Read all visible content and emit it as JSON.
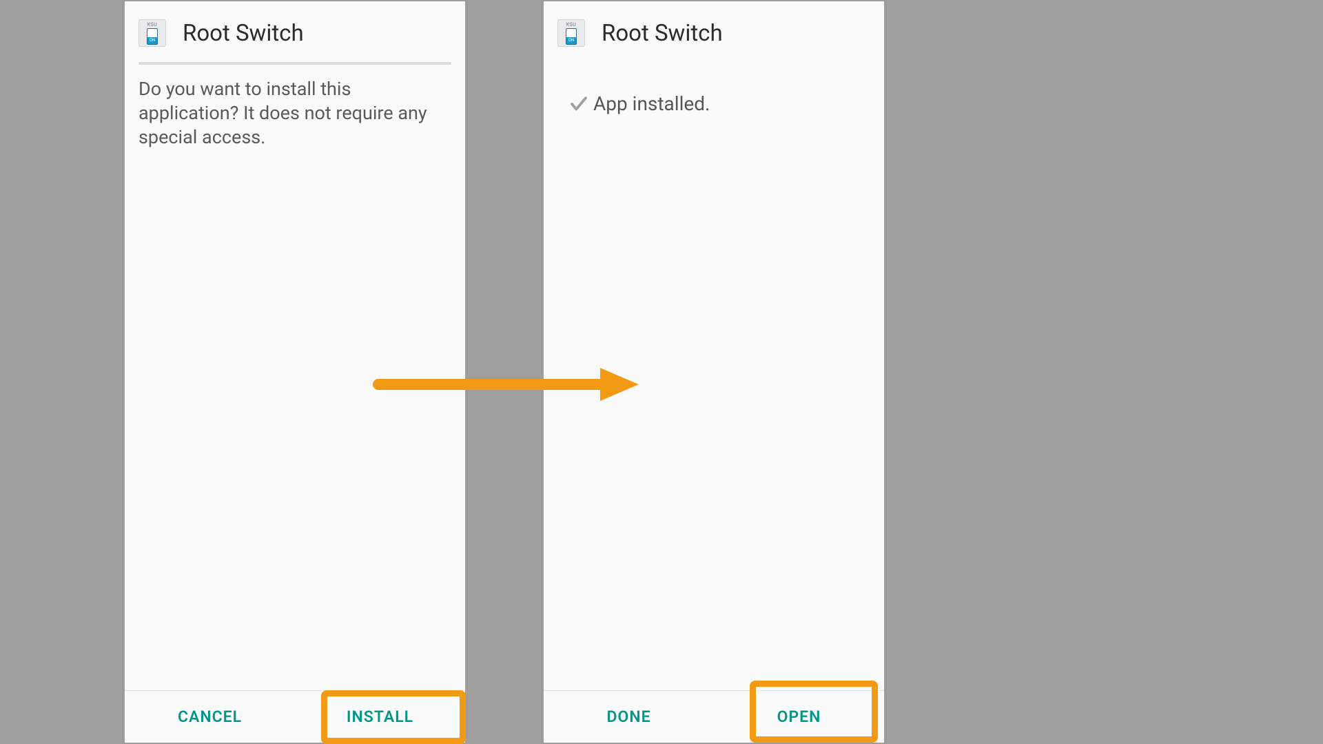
{
  "left": {
    "app_name": "Root Switch",
    "icon_caption": "KSU",
    "icon_tag": "ON",
    "body_text": "Do you want to install this application? It does not require any special access.",
    "cancel_label": "CANCEL",
    "install_label": "INSTALL"
  },
  "right": {
    "app_name": "Root Switch",
    "icon_caption": "KSU",
    "icon_tag": "ON",
    "installed_text": "App installed.",
    "done_label": "DONE",
    "open_label": "OPEN"
  },
  "colors": {
    "accent": "#009688",
    "highlight": "#f29a13"
  }
}
